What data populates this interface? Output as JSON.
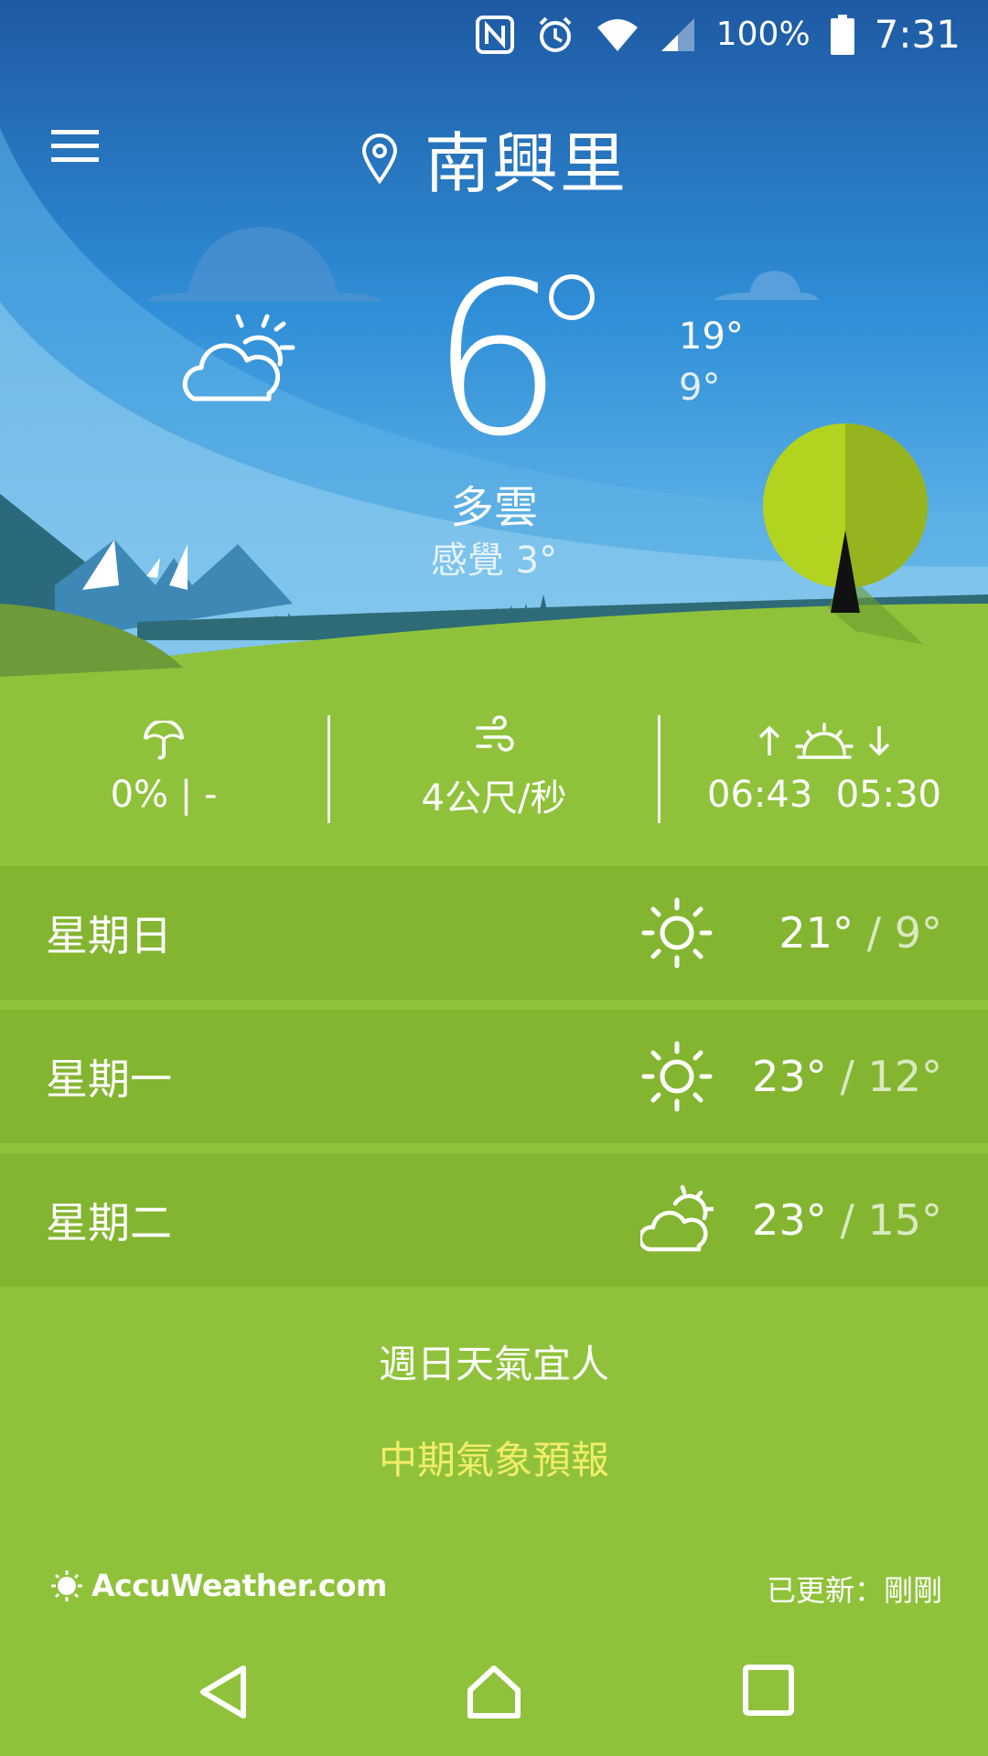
{
  "status_bar": {
    "battery": "100%",
    "time": "7:31",
    "icons": [
      "nfc-icon",
      "alarm-icon",
      "wifi-icon",
      "signal-icon",
      "battery-icon"
    ]
  },
  "header": {
    "location": "南興里",
    "menu_icon": "hamburger-menu-icon",
    "location_icon": "location-pin-icon"
  },
  "current": {
    "temperature": "6",
    "high": "19°",
    "low": "9°",
    "condition": "多雲",
    "feels_like": "感覺 3°",
    "icon": "partly-cloudy-icon"
  },
  "stats": {
    "precipitation": "0% | -",
    "wind": "4公尺/秒",
    "sunrise": "06:43",
    "sunset": "05:30"
  },
  "forecast": [
    {
      "day": "星期日",
      "high": "21°",
      "low": "9°",
      "icon": "sunny-icon"
    },
    {
      "day": "星期一",
      "high": "23°",
      "low": "12°",
      "icon": "sunny-icon"
    },
    {
      "day": "星期二",
      "high": "23°",
      "low": "15°",
      "icon": "partly-cloudy-icon"
    }
  ],
  "summary": "週日天氣宜人",
  "extended_forecast_link": "中期氣象預報",
  "footer": {
    "brand": "AccuWeather.com",
    "updated": "已更新：剛剛"
  },
  "colors": {
    "sky_top": "#1e5fa6",
    "sky_bottom": "#7cc6ec",
    "grass": "#8fc23a",
    "row": "#84b531",
    "link": "#f1ed6a"
  }
}
